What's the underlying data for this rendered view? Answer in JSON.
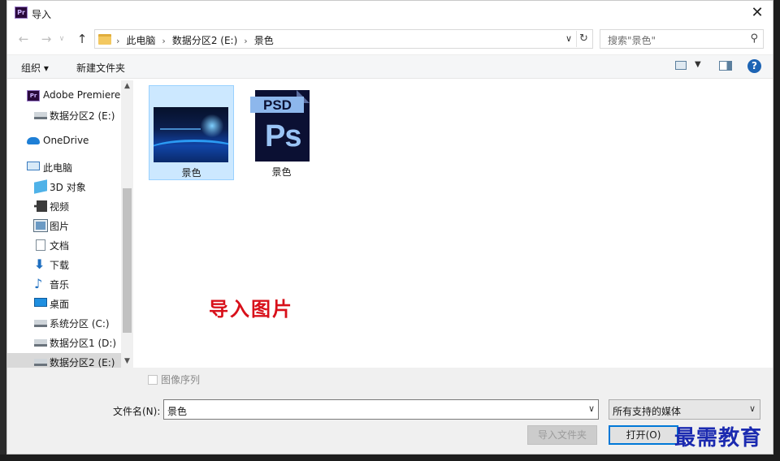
{
  "window": {
    "title": "导入",
    "app_icon": "Pr",
    "close_icon": "close-icon"
  },
  "nav": {
    "back_icon": "←",
    "forward_icon": "→",
    "history_icon": "∨",
    "up_icon": "↑",
    "breadcrumbs": [
      "此电脑",
      "数据分区2 (E:)",
      "景色"
    ],
    "search_placeholder": "搜索\"景色\""
  },
  "toolbar": {
    "organize": "组织 ▾",
    "new_folder": "新建文件夹",
    "help": "?"
  },
  "sidebar": {
    "items": [
      {
        "label": "Adobe Premiere",
        "icon": "premiere-icon"
      },
      {
        "label": "数据分区2 (E:)",
        "icon": "drive-icon"
      },
      {
        "label": "OneDrive",
        "icon": "onedrive-icon"
      },
      {
        "label": "此电脑",
        "icon": "computer-icon"
      },
      {
        "label": "3D 对象",
        "icon": "3d-objects-icon"
      },
      {
        "label": "视频",
        "icon": "video-icon"
      },
      {
        "label": "图片",
        "icon": "pictures-icon"
      },
      {
        "label": "文档",
        "icon": "documents-icon"
      },
      {
        "label": "下载",
        "icon": "downloads-icon"
      },
      {
        "label": "音乐",
        "icon": "music-icon"
      },
      {
        "label": "桌面",
        "icon": "desktop-icon"
      },
      {
        "label": "系统分区 (C:)",
        "icon": "system-drive-icon"
      },
      {
        "label": "数据分区1 (D:)",
        "icon": "drive-icon"
      },
      {
        "label": "数据分区2 (E:)",
        "icon": "drive-icon"
      }
    ]
  },
  "files": [
    {
      "name": "景色",
      "type": "image",
      "selected": true
    },
    {
      "name": "景色",
      "type": "psd",
      "badge": "PSD",
      "glyph": "Ps",
      "selected": false
    }
  ],
  "annotation": "导入图片",
  "bottom": {
    "image_sequence": "图像序列",
    "filename_label": "文件名(N):",
    "filename_value": "景色",
    "filetype_value": "所有支持的媒体",
    "import_folder_button": "导入文件夹",
    "open_button": "打开(O)"
  },
  "watermark": "最需教育",
  "colors": {
    "selection": "#cce8ff",
    "annotation": "#d8101a",
    "help_blue": "#1d64b4",
    "default_button_border": "#0078d7"
  }
}
